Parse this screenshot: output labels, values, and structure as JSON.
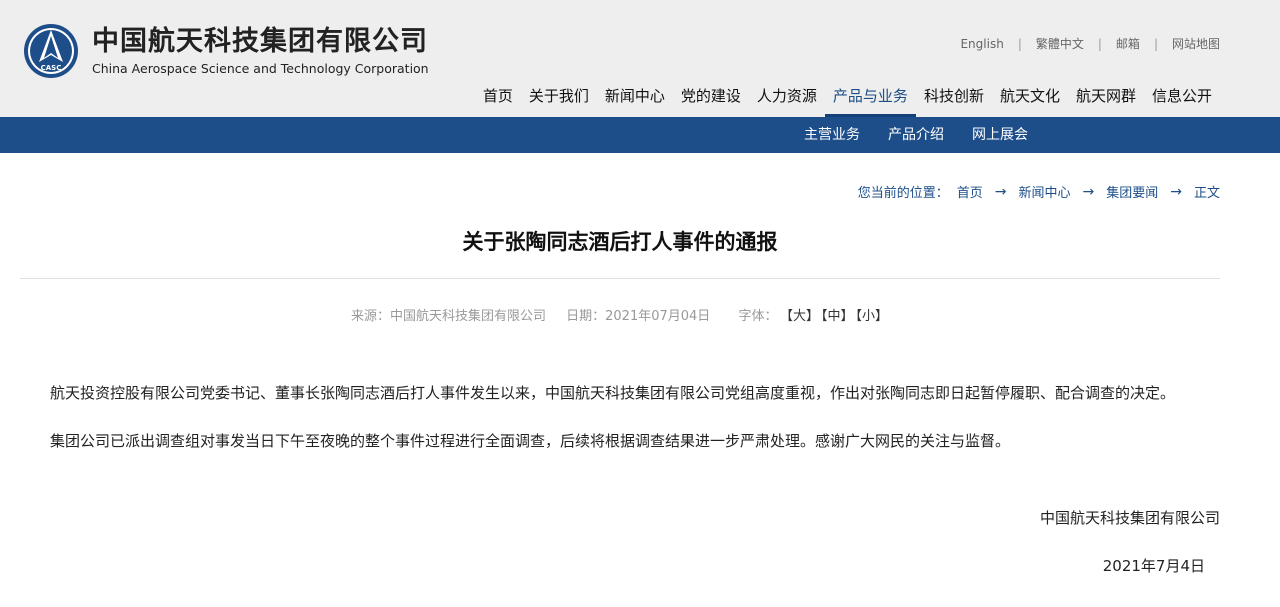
{
  "header": {
    "logo_badge": "CASC",
    "logo_cn": "中国航天科技集团有限公司",
    "logo_en": "China Aerospace Science and Technology Corporation",
    "top_links": [
      "English",
      "繁體中文",
      "邮箱",
      "网站地图"
    ],
    "nav": [
      "首页",
      "关于我们",
      "新闻中心",
      "党的建设",
      "人力资源",
      "产品与业务",
      "科技创新",
      "航天文化",
      "航天网群",
      "信息公开"
    ],
    "active_nav": "产品与业务",
    "subnav": [
      "主营业务",
      "产品介绍",
      "网上展会"
    ]
  },
  "colors": {
    "nav_bar": "#1d4e89",
    "header_bg": "#eeeeee",
    "accent": "#1d4e89"
  },
  "breadcrumb": {
    "label": "您当前的位置：",
    "items": [
      "首页",
      "新闻中心",
      "集团要闻",
      "正文"
    ]
  },
  "article": {
    "title": "关于张陶同志酒后打人事件的通报",
    "source": "来源：中国航天科技集团有限公司",
    "date": "日期：2021年07月04日",
    "font_label": "字体：",
    "font_sizes": [
      "【大】",
      "【中】",
      "【小】"
    ],
    "paragraphs": [
      "航天投资控股有限公司党委书记、董事长张陶同志酒后打人事件发生以来，中国航天科技集团有限公司党组高度重视，作出对张陶同志即日起暂停履职、配合调查的决定。",
      "集团公司已派出调查组对事发当日下午至夜晚的整个事件过程进行全面调查，后续将根据调查结果进一步严肃处理。感谢广大网民的关注与监督。"
    ],
    "sign_company": "中国航天科技集团有限公司",
    "sign_date": "2021年7月4日"
  }
}
